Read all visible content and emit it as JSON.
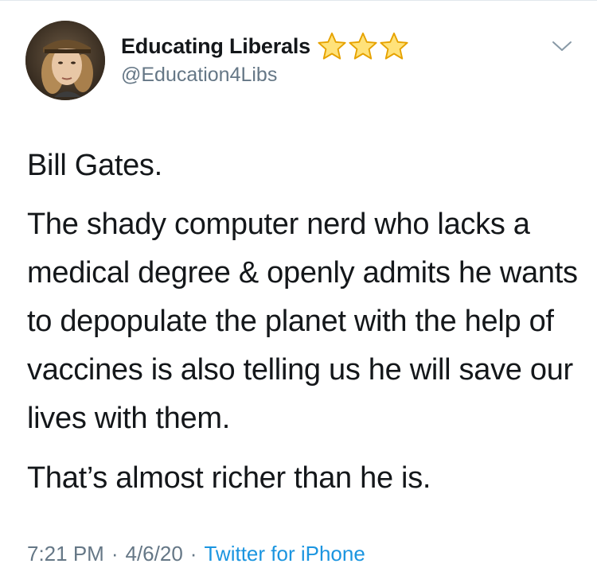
{
  "tweet": {
    "author": {
      "display_name": "Educating Liberals",
      "handle": "@Education4Libs",
      "badge_icons": [
        "star-icon",
        "star-icon",
        "star-icon"
      ]
    },
    "body": [
      "Bill Gates.",
      "The shady computer nerd who lacks a medical degree & openly admits he wants to depopulate the planet with the help of vaccines is also telling us he will save our lives with them.",
      "That’s almost richer than he is."
    ],
    "time": "7:21 PM",
    "date": "4/6/20",
    "separator": "·",
    "source": "Twitter for iPhone",
    "menu_icon": "chevron-down-icon"
  },
  "colors": {
    "text": "#14171a",
    "secondary": "#657786",
    "link": "#1b95e0",
    "star_fill": "#ffe27a",
    "star_outline": "#e6a200"
  }
}
